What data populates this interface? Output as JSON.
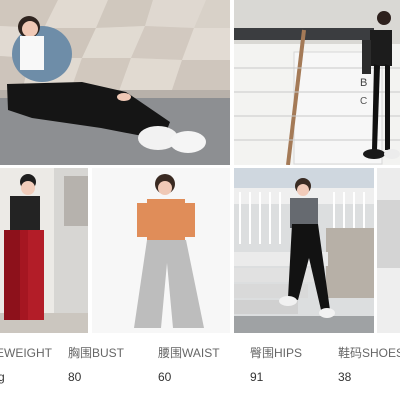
{
  "gallery": {
    "photos": [
      {
        "name": "photo-1"
      },
      {
        "name": "photo-2",
        "storefront_text": "B\nC"
      },
      {
        "name": "photo-3"
      },
      {
        "name": "photo-4"
      },
      {
        "name": "photo-5"
      },
      {
        "name": "photo-6"
      }
    ]
  },
  "measurements": {
    "labels": [
      "EWEIGHT",
      "胸围BUST",
      "腰围WAIST",
      "臀围HIPS",
      "鞋码SHOES"
    ],
    "values": [
      "g",
      "80",
      "60",
      "91",
      "38"
    ]
  },
  "colors": {
    "label": "#666666",
    "value": "#333333"
  }
}
